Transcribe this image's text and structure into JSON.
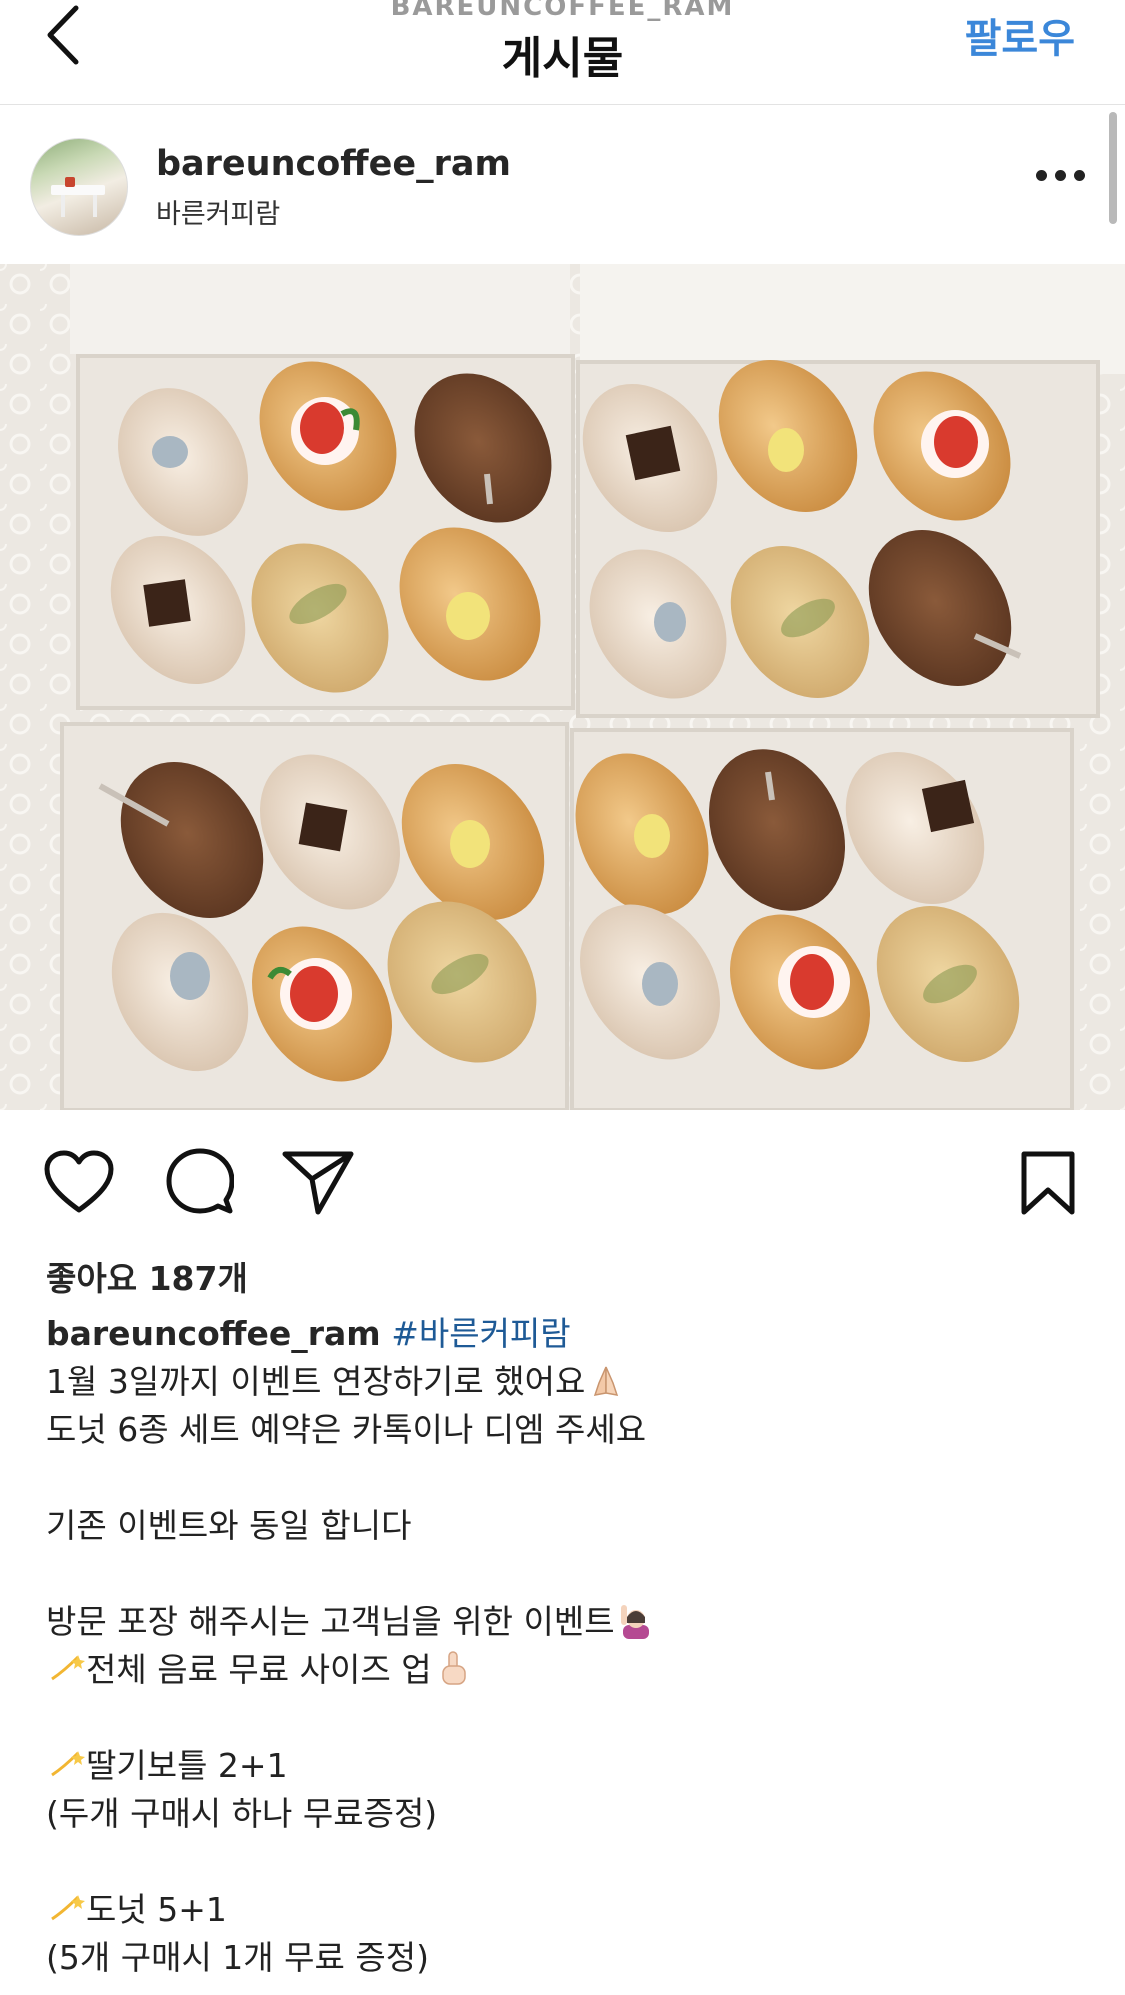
{
  "header": {
    "subtitle": "BAREUNCOFFEE_RAM",
    "title": "게시물",
    "follow_label": "팔로우"
  },
  "post": {
    "username": "bareuncoffee_ram",
    "location": "바른커피람",
    "likes": "좋아요 187개"
  },
  "caption": {
    "username": "bareuncoffee_ram",
    "hashtag": "#바른커피람",
    "lines": [
      "1월 3일까지 이벤트 연장하기로 했어요",
      "도넛 6종 세트 예약은 카톡이나 디엠 주세요",
      "",
      "기존 이벤트와 동일 합니다",
      "",
      "방문 포장 해주시는 고객님을 위한 이벤트",
      "전체 음료 무료 사이즈 업",
      "",
      "딸기보틀 2+1",
      "(두개 구매시 하나 무료증정)",
      "",
      "도넛 5+1",
      "(5개 구매시 1개 무료 증정)"
    ]
  },
  "icons": {
    "back": "chevron-left-icon",
    "more": "more-horizontal-icon",
    "like": "heart-icon",
    "comment": "comment-bubble-icon",
    "share": "paper-plane-icon",
    "save": "bookmark-icon",
    "emoji_pray": "folded-hands-emoji",
    "emoji_raise": "person-raising-hand-emoji",
    "emoji_point": "pointing-up-emoji",
    "emoji_sparkle": "dizzy-star-emoji"
  },
  "colors": {
    "accent": "#3b87d9",
    "hashtag": "#1e5a96"
  }
}
